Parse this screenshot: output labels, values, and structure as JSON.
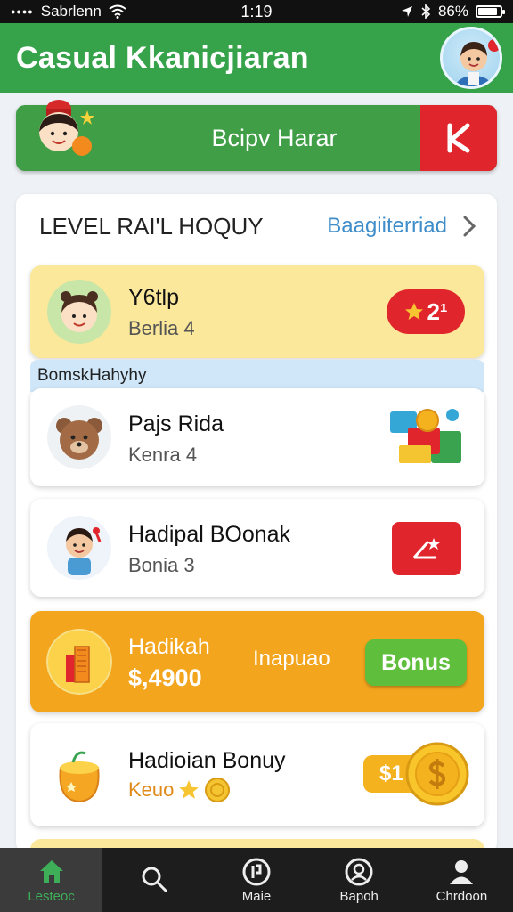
{
  "status_bar": {
    "carrier": "Sabrlenn",
    "time": "1:19",
    "battery": "86%",
    "battery_level": 0.86
  },
  "header": {
    "title": "Casual Kkanicjiaran"
  },
  "banner": {
    "text": "Bcipv Harar"
  },
  "panel": {
    "title": "LEVEL RAI'L HOQUY",
    "link": "Baagiiterriad",
    "section_label": "BomskHahyhy",
    "items": [
      {
        "title": "Y6tlp",
        "subtitle": "Berlia 4",
        "badge": "2¹"
      },
      {
        "title": "Pajs Rida",
        "subtitle": "Kenra 4"
      },
      {
        "title": "Hadipal BOonak",
        "subtitle": "Bonia 3"
      },
      {
        "title": "Hadikah",
        "amount": "$,4900",
        "middle": "Inapuao",
        "button": "Bonus"
      },
      {
        "title": "Hadioian Bonuy",
        "subtitle": "Keuo",
        "coin_label": "$1"
      }
    ]
  },
  "nav": [
    {
      "label": "Lesteoc",
      "icon": "home-icon",
      "active": true
    },
    {
      "label": "",
      "icon": "search-icon",
      "active": false
    },
    {
      "label": "Maie",
      "icon": "medal-icon",
      "active": false
    },
    {
      "label": "Bapoh",
      "icon": "face-icon",
      "active": false
    },
    {
      "label": "Chrdoon",
      "icon": "person-icon",
      "active": false
    }
  ],
  "colors": {
    "header": "#36a24a",
    "red": "#e0262c",
    "yellow": "#fbe89a",
    "orange": "#f3a51e",
    "green_button": "#5fbf3d",
    "link": "#3f8dc9"
  }
}
